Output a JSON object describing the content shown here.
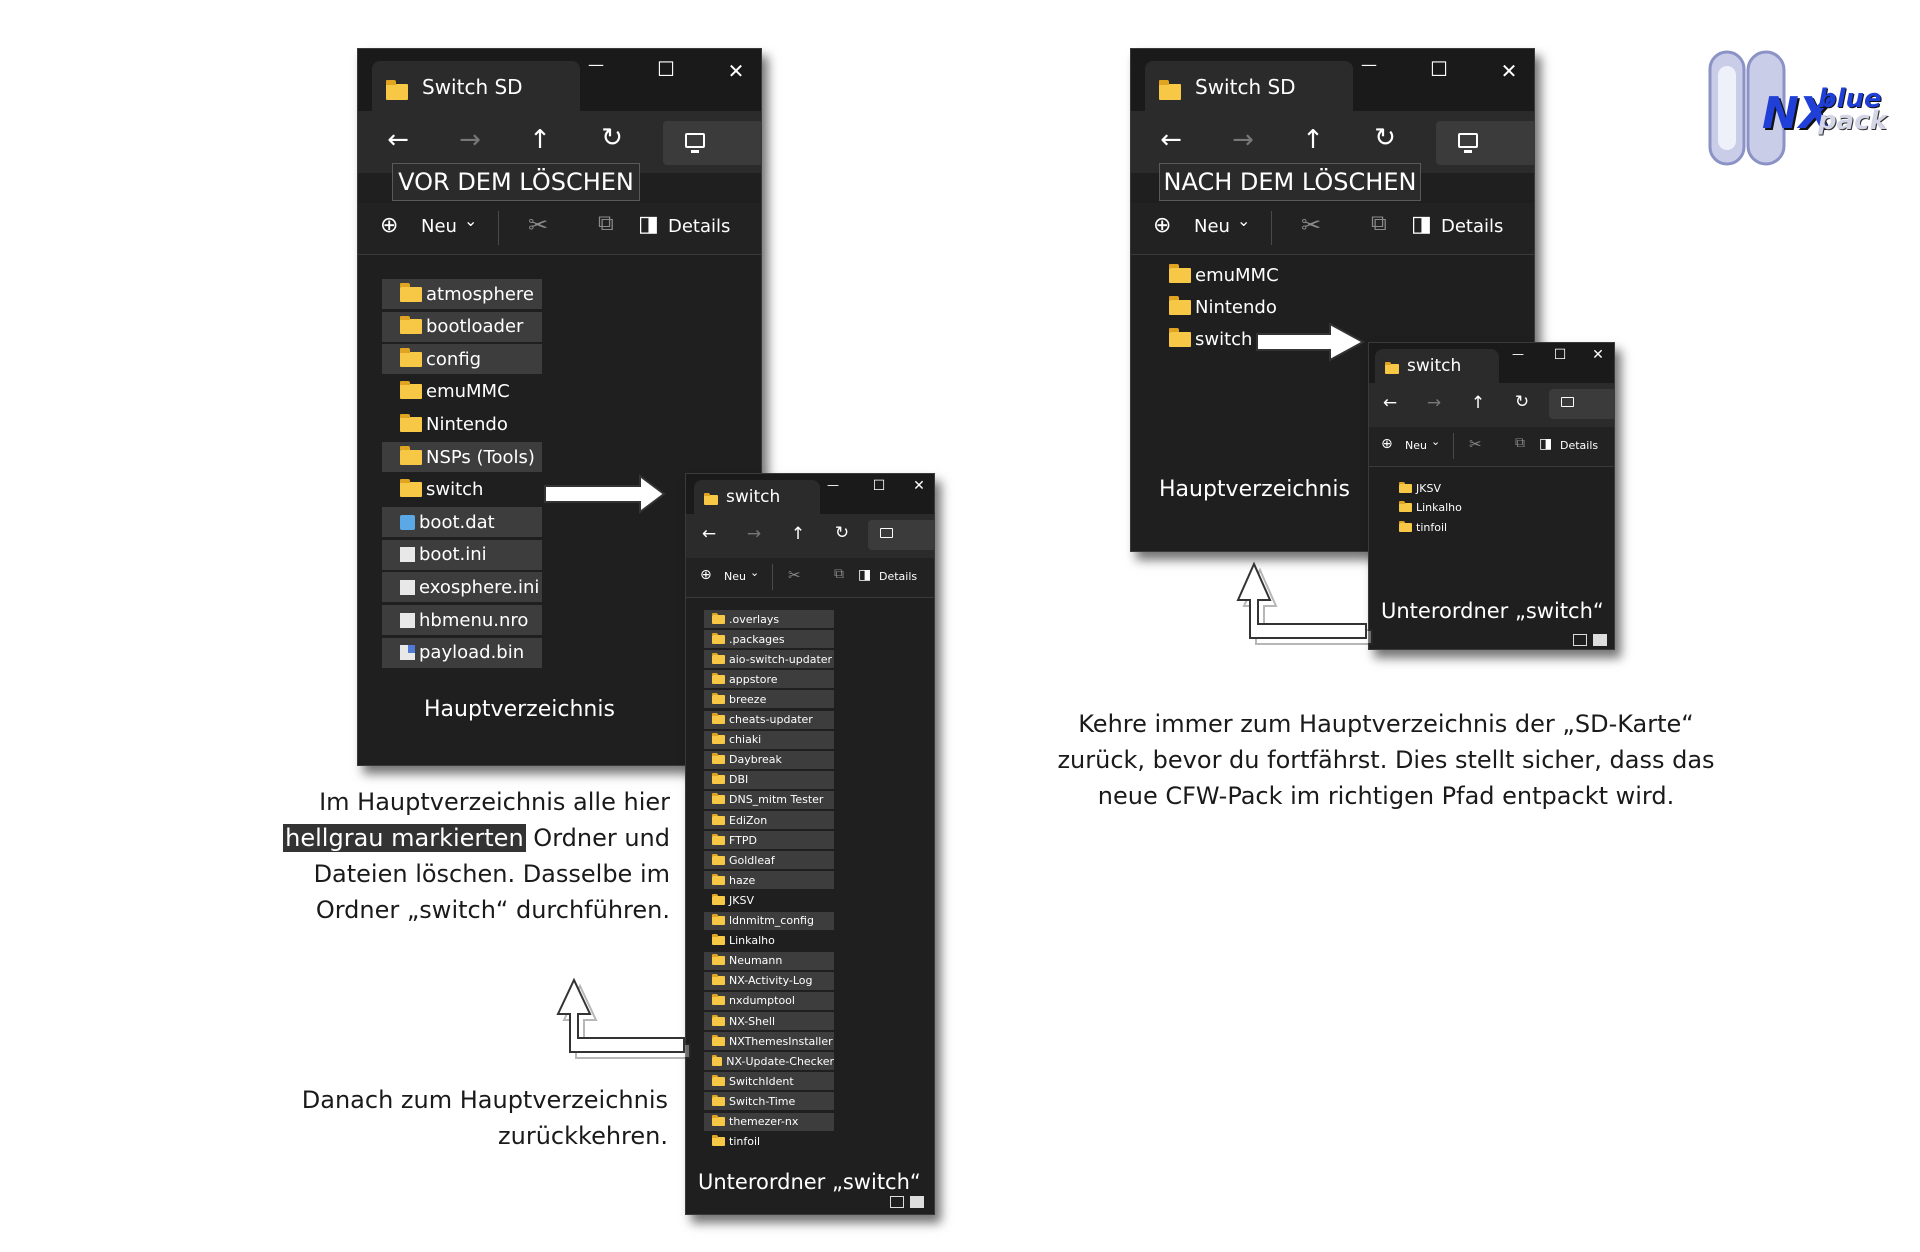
{
  "left_main": {
    "tab_title": "Switch SD",
    "caption": "VOR DEM LÖSCHEN",
    "cmd_new": "Neu",
    "cmd_details": "Details",
    "items": [
      {
        "name": "atmosphere",
        "type": "folder",
        "highlighted": true
      },
      {
        "name": "bootloader",
        "type": "folder",
        "highlighted": true
      },
      {
        "name": "config",
        "type": "folder",
        "highlighted": true
      },
      {
        "name": "emuMMC",
        "type": "folder",
        "highlighted": false
      },
      {
        "name": "Nintendo",
        "type": "folder",
        "highlighted": false
      },
      {
        "name": "NSPs (Tools)",
        "type": "folder",
        "highlighted": true
      },
      {
        "name": "switch",
        "type": "folder",
        "highlighted": false
      },
      {
        "name": "boot.dat",
        "type": "dat",
        "highlighted": true
      },
      {
        "name": "boot.ini",
        "type": "file",
        "highlighted": true
      },
      {
        "name": "exosphere.ini",
        "type": "file",
        "highlighted": true
      },
      {
        "name": "hbmenu.nro",
        "type": "file",
        "highlighted": true
      },
      {
        "name": "payload.bin",
        "type": "bin",
        "highlighted": true
      }
    ],
    "footer": "Hauptverzeichnis"
  },
  "left_sub": {
    "tab_title": "switch",
    "cmd_new": "Neu",
    "cmd_details": "Details",
    "items": [
      {
        "name": ".overlays",
        "highlighted": true
      },
      {
        "name": ".packages",
        "highlighted": true
      },
      {
        "name": "aio-switch-updater",
        "highlighted": true
      },
      {
        "name": "appstore",
        "highlighted": true
      },
      {
        "name": "breeze",
        "highlighted": true
      },
      {
        "name": "cheats-updater",
        "highlighted": true
      },
      {
        "name": "chiaki",
        "highlighted": true
      },
      {
        "name": "Daybreak",
        "highlighted": true
      },
      {
        "name": "DBI",
        "highlighted": true
      },
      {
        "name": "DNS_mitm Tester",
        "highlighted": true
      },
      {
        "name": "EdiZon",
        "highlighted": true
      },
      {
        "name": "FTPD",
        "highlighted": true
      },
      {
        "name": "Goldleaf",
        "highlighted": true
      },
      {
        "name": "haze",
        "highlighted": true
      },
      {
        "name": "JKSV",
        "highlighted": false
      },
      {
        "name": "ldnmitm_config",
        "highlighted": true
      },
      {
        "name": "Linkalho",
        "highlighted": false
      },
      {
        "name": "Neumann",
        "highlighted": true
      },
      {
        "name": "NX-Activity-Log",
        "highlighted": true
      },
      {
        "name": "nxdumptool",
        "highlighted": true
      },
      {
        "name": "NX-Shell",
        "highlighted": true
      },
      {
        "name": "NXThemesInstaller",
        "highlighted": true
      },
      {
        "name": "NX-Update-Checker",
        "highlighted": true
      },
      {
        "name": "SwitchIdent",
        "highlighted": true
      },
      {
        "name": "Switch-Time",
        "highlighted": true
      },
      {
        "name": "themezer-nx",
        "highlighted": true
      },
      {
        "name": "tinfoil",
        "highlighted": false
      }
    ],
    "footer": "Unterordner „switch“"
  },
  "right_main": {
    "tab_title": "Switch SD",
    "caption": "NACH DEM LÖSCHEN",
    "cmd_new": "Neu",
    "cmd_details": "Details",
    "items": [
      {
        "name": "emuMMC"
      },
      {
        "name": "Nintendo"
      },
      {
        "name": "switch"
      }
    ],
    "footer": "Hauptverzeichnis"
  },
  "right_sub": {
    "tab_title": "switch",
    "cmd_new": "Neu",
    "cmd_details": "Details",
    "items": [
      {
        "name": "JKSV"
      },
      {
        "name": "Linkalho"
      },
      {
        "name": "tinfoil"
      }
    ],
    "footer": "Unterordner „switch“"
  },
  "texts": {
    "left_instruction_line1": "Im Hauptverzeichnis alle hier",
    "left_instruction_highlight": "hellgrau markierten",
    "left_instruction_line2_rest": "Ordner und",
    "left_instruction_line3": "Dateien löschen. Dasselbe im",
    "left_instruction_line4": "Ordner „switch“ durchführen.",
    "return_line1": "Danach zum Hauptverzeichnis",
    "return_line2": "zurückkehren.",
    "right_line1": "Kehre immer zum Hauptverzeichnis der „SD-Karte“",
    "right_line2": "zurück, bevor du fortfährst. Dies stellt sicher, dass das",
    "right_line3": "neue CFW-Pack im richtigen Pfad entpackt wird."
  },
  "logo": {
    "nx": "NX",
    "blue": "blue",
    "pack": "pack"
  },
  "icons": {
    "back": "←",
    "forward": "→",
    "up": "↑",
    "refresh": "↻",
    "minimize": "—",
    "maximize": "☐",
    "close": "✕",
    "new": "⊕",
    "cut": "✂",
    "copy": "⧉",
    "details": "◨",
    "chevron": "⌄"
  },
  "colors": {
    "window_bg": "#1f1f1f",
    "highlight_bg": "#3d3d3d",
    "folder_yellow": "#f7c846",
    "logo_blue": "#1f3fd6"
  }
}
